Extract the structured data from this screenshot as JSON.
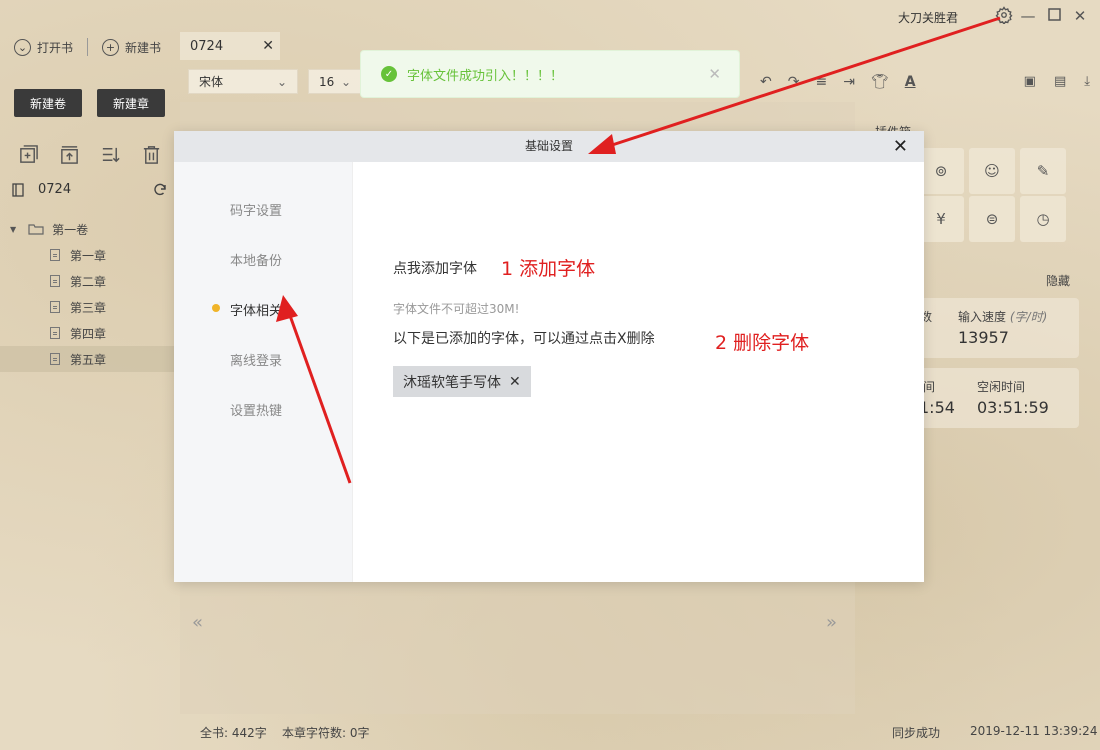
{
  "titlebar": {
    "username": "大刀关胜君"
  },
  "left": {
    "open_book": "打开书",
    "new_book": "新建书",
    "new_volume": "新建卷",
    "new_chapter": "新建章",
    "book_name": "0724",
    "volume": "第一卷",
    "chapters": [
      "第一章",
      "第二章",
      "第三章",
      "第四章",
      "第五章"
    ],
    "selected_chapter": 4
  },
  "editor": {
    "tab_title": "0724",
    "font": "宋体",
    "size": "16"
  },
  "right_panel": {
    "plugin_title": "插件箱",
    "hide": "隐藏",
    "card1": {
      "label_left": "数",
      "label_right": "输入速度",
      "label_right_unit": "(字/时)",
      "value_right": "13957"
    },
    "card2": {
      "label_left": "间",
      "label_right": "空闲时间",
      "value_left": "1:54",
      "value_right": "03:51:59"
    }
  },
  "status": {
    "book_total": "全书: 442字",
    "chapter_chars": "本章字符数: 0字",
    "sync": "同步成功",
    "datetime": "2019-12-11 13:39:24"
  },
  "toast": {
    "message": "字体文件成功引入！！！！"
  },
  "modal": {
    "title": "基础设置",
    "side_items": [
      "码字设置",
      "本地备份",
      "字体相关",
      "离线登录",
      "设置热键"
    ],
    "active_item": 2,
    "add_font": "点我添加字体",
    "hint": "字体文件不可超过30M!",
    "desc": "以下是已添加的字体，可以通过点击X删除",
    "font_tag": "沐瑶软笔手写体"
  },
  "annotations": {
    "a1": "1 添加字体",
    "a2": "2 删除字体"
  },
  "colors": {
    "accent_dot": "#f0b429",
    "toast_green": "#67c23a",
    "annotation_red": "#e02020"
  }
}
